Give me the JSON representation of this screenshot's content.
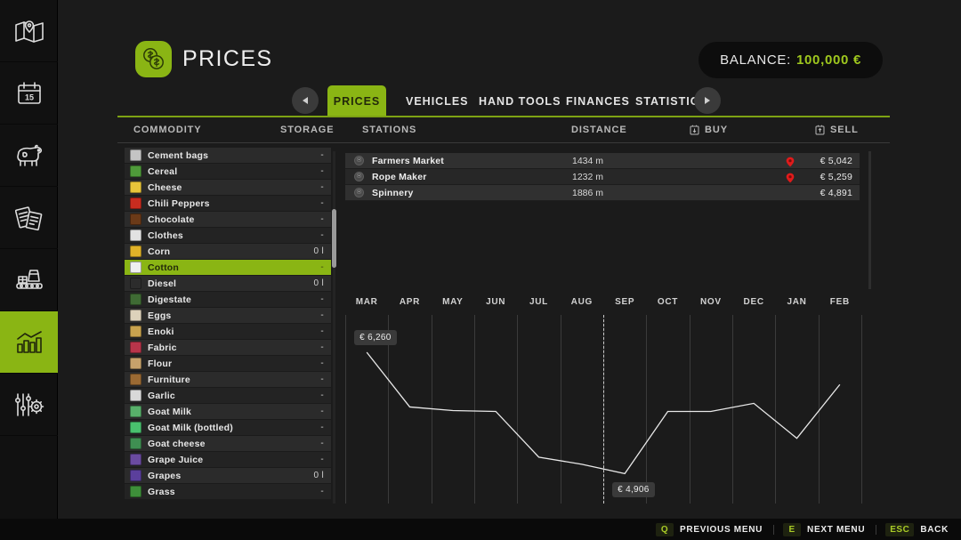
{
  "sidebar": {
    "items": [
      {
        "name": "map",
        "icon": "map-icon",
        "active": false
      },
      {
        "name": "calendar",
        "icon": "calendar-icon",
        "active": false
      },
      {
        "name": "animals",
        "icon": "cow-icon",
        "active": false
      },
      {
        "name": "contracts",
        "icon": "documents-icon",
        "active": false
      },
      {
        "name": "production",
        "icon": "factory-icon",
        "active": false
      },
      {
        "name": "prices",
        "icon": "bar-chart-icon",
        "active": true
      },
      {
        "name": "settings",
        "icon": "sliders-gear-icon",
        "active": false
      }
    ]
  },
  "header": {
    "title": "PRICES",
    "icon": "coins-icon",
    "balance_label": "BALANCE:",
    "balance_value": "100,000 €",
    "accent_color": "#8ab514"
  },
  "tabs": {
    "prev_icon": "chevron-left-icon",
    "next_icon": "chevron-right-icon",
    "items": [
      {
        "label": "PRICES",
        "active": true
      },
      {
        "label": "VEHICLES",
        "active": false
      },
      {
        "label": "HAND TOOLS",
        "active": false
      },
      {
        "label": "FINANCES",
        "active": false
      },
      {
        "label": "STATISTICS",
        "active": false
      }
    ]
  },
  "columns": [
    {
      "label": "COMMODITY",
      "icon": null
    },
    {
      "label": "STORAGE",
      "icon": null
    },
    {
      "label": "STATIONS",
      "icon": null
    },
    {
      "label": "DISTANCE",
      "icon": null
    },
    {
      "label": "BUY",
      "icon": "buy-icon"
    },
    {
      "label": "SELL",
      "icon": "sell-icon"
    }
  ],
  "commodities": [
    {
      "name": "Cement bags",
      "storage": "-",
      "selected": false,
      "color": "#c4c4c4"
    },
    {
      "name": "Cereal",
      "storage": "-",
      "selected": false,
      "color": "#4f9a3a"
    },
    {
      "name": "Cheese",
      "storage": "-",
      "selected": false,
      "color": "#e8c53a"
    },
    {
      "name": "Chili Peppers",
      "storage": "-",
      "selected": false,
      "color": "#c92c1f"
    },
    {
      "name": "Chocolate",
      "storage": "-",
      "selected": false,
      "color": "#6b3a18"
    },
    {
      "name": "Clothes",
      "storage": "-",
      "selected": false,
      "color": "#e2e2e2"
    },
    {
      "name": "Corn",
      "storage": "0 l",
      "selected": false,
      "color": "#e0b228"
    },
    {
      "name": "Cotton",
      "storage": "-",
      "selected": true,
      "color": "#efefef"
    },
    {
      "name": "Diesel",
      "storage": "0 l",
      "selected": false,
      "color": "#2c2c2c"
    },
    {
      "name": "Digestate",
      "storage": "-",
      "selected": false,
      "color": "#3f6b34"
    },
    {
      "name": "Eggs",
      "storage": "-",
      "selected": false,
      "color": "#ddd2bb"
    },
    {
      "name": "Enoki",
      "storage": "-",
      "selected": false,
      "color": "#c9a34e"
    },
    {
      "name": "Fabric",
      "storage": "-",
      "selected": false,
      "color": "#b8354a"
    },
    {
      "name": "Flour",
      "storage": "-",
      "selected": false,
      "color": "#c7a26b"
    },
    {
      "name": "Furniture",
      "storage": "-",
      "selected": false,
      "color": "#9b6a33"
    },
    {
      "name": "Garlic",
      "storage": "-",
      "selected": false,
      "color": "#d9d9d9"
    },
    {
      "name": "Goat Milk",
      "storage": "-",
      "selected": false,
      "color": "#58b06a"
    },
    {
      "name": "Goat Milk (bottled)",
      "storage": "-",
      "selected": false,
      "color": "#49c16e"
    },
    {
      "name": "Goat cheese",
      "storage": "-",
      "selected": false,
      "color": "#3f8f52"
    },
    {
      "name": "Grape Juice",
      "storage": "-",
      "selected": false,
      "color": "#6a4ba0"
    },
    {
      "name": "Grapes",
      "storage": "0 l",
      "selected": false,
      "color": "#5b3f9c"
    },
    {
      "name": "Grass",
      "storage": "-",
      "selected": false,
      "color": "#3e8f3a"
    }
  ],
  "stations": [
    {
      "name": "Farmers Market",
      "distance": "1434 m",
      "price": "€ 5,042",
      "pin": true,
      "badge_icon": "station-icon"
    },
    {
      "name": "Rope Maker",
      "distance": "1232 m",
      "price": "€ 5,259",
      "pin": true,
      "badge_icon": "station-icon"
    },
    {
      "name": "Spinnery",
      "distance": "1886 m",
      "price": "€ 4,891",
      "pin": false,
      "badge_icon": "station-icon"
    }
  ],
  "chart_data": {
    "type": "line",
    "title": "",
    "xlabel": "",
    "ylabel": "",
    "categories": [
      "MAR",
      "APR",
      "MAY",
      "JUN",
      "JUL",
      "AUG",
      "SEP",
      "OCT",
      "NOV",
      "DEC",
      "JAN",
      "FEB"
    ],
    "values": [
      6260,
      5650,
      5610,
      5600,
      5090,
      5010,
      4906,
      5600,
      5600,
      5690,
      5300,
      5900
    ],
    "ylim": [
      4850,
      6300
    ],
    "grid": true,
    "legend": null,
    "max_label": "€ 6,260",
    "min_label": "€ 4,906",
    "max_point_index": 0,
    "min_point_index": 6,
    "current_marker": {
      "between": [
        "AUG",
        "SEP"
      ],
      "style": "dashed"
    },
    "line_color": "#e8e8e8"
  },
  "bottombar": {
    "hints": [
      {
        "key": "Q",
        "label": "PREVIOUS MENU"
      },
      {
        "key": "E",
        "label": "NEXT MENU"
      },
      {
        "key": "ESC",
        "label": "BACK"
      }
    ]
  }
}
